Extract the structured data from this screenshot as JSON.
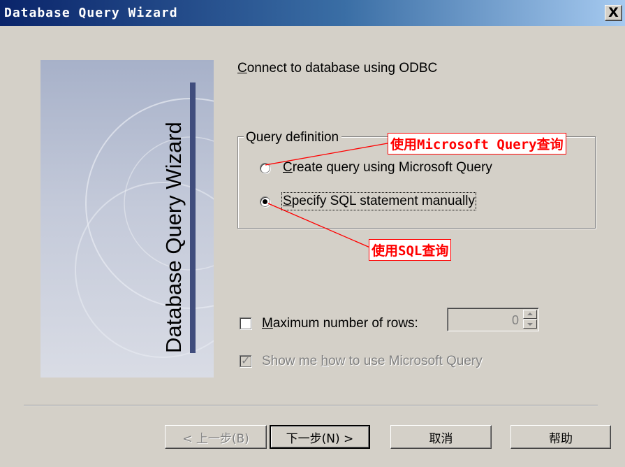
{
  "window": {
    "title": "Database Query Wizard",
    "close_glyph": "X"
  },
  "side_panel": {
    "title": "Database Query Wizard"
  },
  "connect_label": {
    "mnemonic": "C",
    "rest": "onnect to database using  ODBC"
  },
  "query_definition": {
    "legend": "Query definition",
    "options": [
      {
        "mnemonic": "C",
        "rest": "reate query using Microsoft Query",
        "selected": false
      },
      {
        "mnemonic": "S",
        "rest": "pecify SQL statement manually",
        "selected": true
      }
    ]
  },
  "max_rows": {
    "mnemonic": "M",
    "rest": "aximum number of rows:",
    "checked": false,
    "value": "0"
  },
  "show_me": {
    "before": "Show me ",
    "mnemonic": "h",
    "after": "ow to use Microsoft Query",
    "checked": true,
    "enabled": false
  },
  "buttons": {
    "back": "< 上一步(B)",
    "next": "下一步(N) >",
    "cancel": "取消",
    "help": "帮助"
  },
  "annotations": {
    "ms_query": "使用Microsoft Query查询",
    "sql": "使用SQL查询"
  },
  "colors": {
    "dialog_bg": "#d4d0c8",
    "title_gradient_start": "#0a246a",
    "title_gradient_end": "#a6caf0",
    "annotation": "#ff0000"
  }
}
